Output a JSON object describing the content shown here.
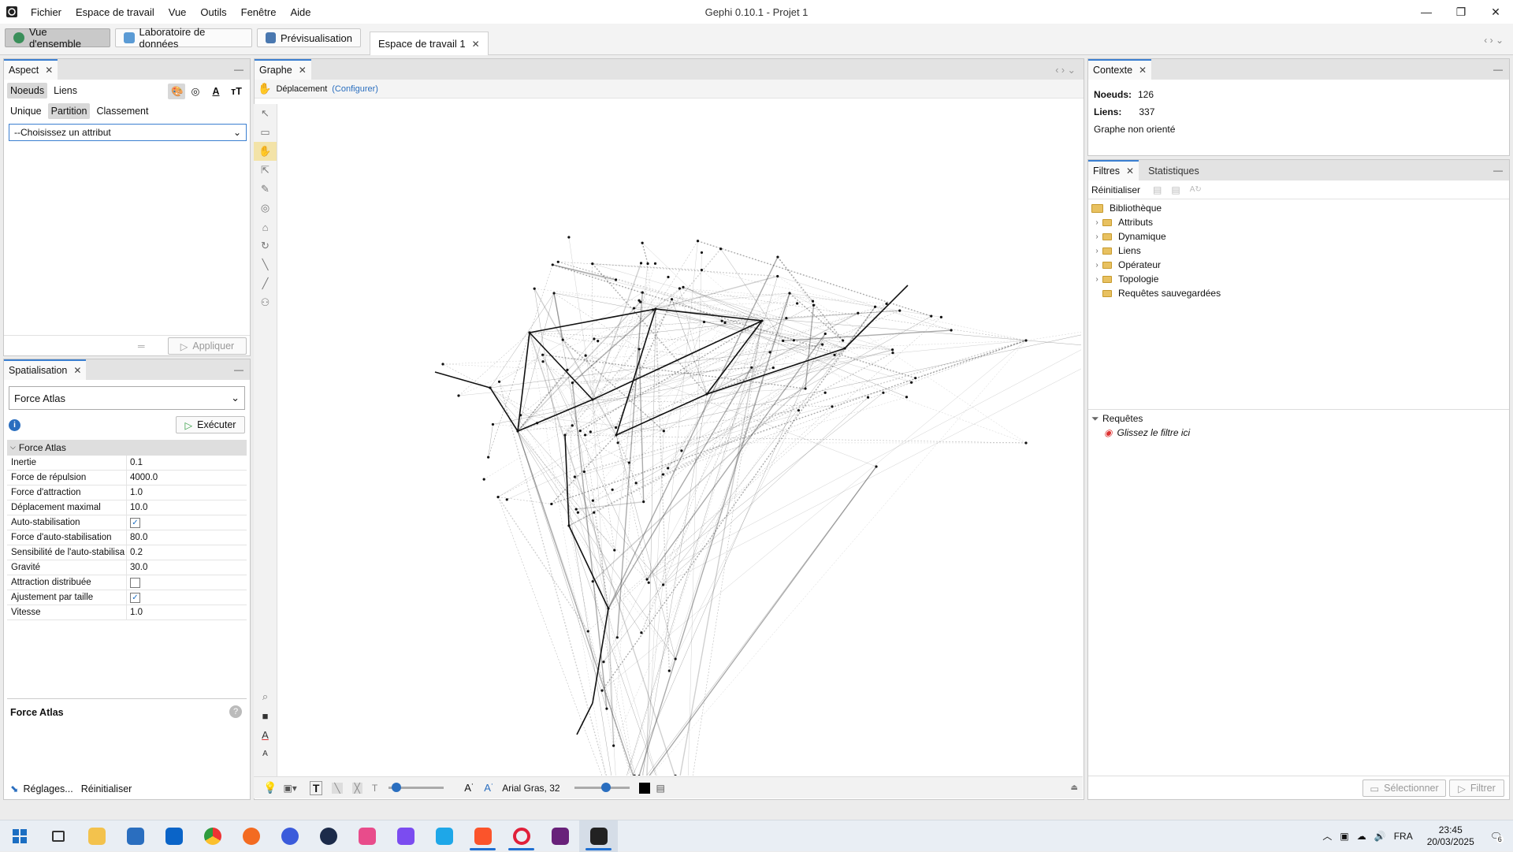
{
  "window": {
    "title": "Gephi 0.10.1 - Projet 1"
  },
  "menu": [
    "Fichier",
    "Espace de travail",
    "Vue",
    "Outils",
    "Fenêtre",
    "Aide"
  ],
  "toolbar": {
    "overview": "Vue d'ensemble",
    "datalab": "Laboratoire de données",
    "preview": "Prévisualisation",
    "workspace_tab": "Espace de travail 1"
  },
  "aspect": {
    "title": "Aspect",
    "tabs": [
      "Noeuds",
      "Liens"
    ],
    "modes": [
      "Unique",
      "Partition",
      "Classement"
    ],
    "attribute_placeholder": "--Choisissez un attribut",
    "apply": "Appliquer"
  },
  "layout": {
    "title": "Spatialisation",
    "algorithm": "Force Atlas",
    "run": "Exécuter",
    "section": "Force Atlas",
    "properties": [
      {
        "name": "Inertie",
        "value": "0.1"
      },
      {
        "name": "Force de répulsion",
        "value": "4000.0"
      },
      {
        "name": "Force d'attraction",
        "value": "1.0"
      },
      {
        "name": "Déplacement maximal",
        "value": "10.0"
      },
      {
        "name": "Auto-stabilisation",
        "value": "true"
      },
      {
        "name": "Force d'auto-stabilisation",
        "value": "80.0"
      },
      {
        "name": "Sensibilité de l'auto-stabilisa",
        "value": "0.2"
      },
      {
        "name": "Gravité",
        "value": "30.0"
      },
      {
        "name": "Attraction distribuée",
        "value": "false"
      },
      {
        "name": "Ajustement par taille",
        "value": "true"
      },
      {
        "name": "Vitesse",
        "value": "1.0"
      }
    ],
    "desc_title": "Force Atlas",
    "settings": "Réglages...",
    "reset": "Réinitialiser"
  },
  "graph": {
    "title": "Graphe",
    "tool": "Déplacement",
    "configure": "(Configurer)",
    "font": "Arial Gras, 32"
  },
  "context": {
    "title": "Contexte",
    "nodes_label": "Noeuds:",
    "nodes": "126",
    "edges_label": "Liens:",
    "edges": "337",
    "type": "Graphe non orienté"
  },
  "filters": {
    "tabs": [
      "Filtres",
      "Statistiques"
    ],
    "reset": "Réinitialiser",
    "library": "Bibliothèque",
    "items": [
      "Attributs",
      "Dynamique",
      "Liens",
      "Opérateur",
      "Topologie",
      "Requêtes sauvegardées"
    ],
    "queries": "Requêtes",
    "drop": "Glissez le filtre ici",
    "select": "Sélectionner",
    "filter": "Filtrer"
  },
  "taskbar": {
    "lang": "FRA",
    "time": "23:45",
    "date": "20/03/2025",
    "notifications": "6"
  }
}
